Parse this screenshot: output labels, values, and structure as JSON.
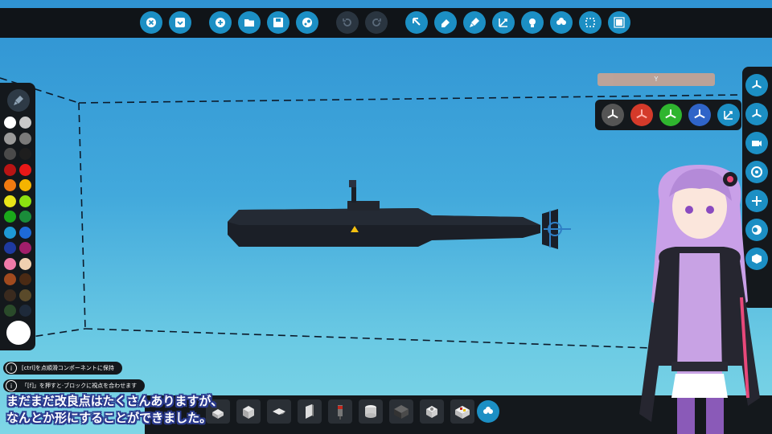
{
  "toolbar": {
    "buttons": [
      {
        "icon": "close-icon"
      },
      {
        "icon": "collapse-icon"
      },
      {
        "icon": "new-icon"
      },
      {
        "icon": "folder-icon"
      },
      {
        "icon": "save-icon"
      },
      {
        "icon": "steam-icon"
      },
      {
        "icon": "undo-icon"
      },
      {
        "icon": "redo-icon"
      },
      {
        "icon": "select-cursor-icon"
      },
      {
        "icon": "eraser-icon"
      },
      {
        "icon": "paint-icon"
      },
      {
        "icon": "transform-icon"
      },
      {
        "icon": "light-icon"
      },
      {
        "icon": "components-icon"
      },
      {
        "icon": "marquee-select-icon"
      },
      {
        "icon": "chip-icon"
      }
    ]
  },
  "palette": {
    "colors": [
      "#ffffff",
      "#c8c8c8",
      "#9a9a9a",
      "#7a7a7a",
      "#4a4a4a",
      "#1e1e1e",
      "#b81414",
      "#e81818",
      "#f07a10",
      "#f5b400",
      "#e8e418",
      "#8ce010",
      "#1aa81a",
      "#1a8c3a",
      "#1e9ad6",
      "#1e6ad6",
      "#1e3aa0",
      "#a01e6a",
      "#f07aa8",
      "#f0d0b0",
      "#a04a1e",
      "#4a2a14",
      "#3a2a1e",
      "#5a4a2a",
      "#2a4a2a",
      "#1e2a3a"
    ],
    "selected": "#ffffff"
  },
  "viewport": {
    "axis_label": "Y",
    "view_buttons": [
      {
        "icon": "view-axis-gray-icon",
        "color": "#555555"
      },
      {
        "icon": "view-axis-red-icon",
        "color": "#d43a2a"
      },
      {
        "icon": "view-axis-green-icon",
        "color": "#2fb52f"
      },
      {
        "icon": "view-axis-blue-icon",
        "color": "#2f64c8"
      },
      {
        "icon": "view-expand-icon",
        "color": "#1c8fc4"
      }
    ]
  },
  "right_panel": {
    "buttons": [
      "axis-icon",
      "axis-icon",
      "camera-icon",
      "target-icon",
      "arrows-icon",
      "orbit-icon",
      "block-icon"
    ]
  },
  "hints": [
    {
      "text": "[ctrl]を点順滑コンポーネントに保持"
    },
    {
      "text": "「[f]」を押すと·ブロックに視点を合わせます"
    }
  ],
  "bottom_bar": {
    "blocks": [
      "block-slab-icon",
      "block-cube-icon",
      "block-wedge-icon",
      "block-panel-icon",
      "block-thruster-icon",
      "block-cylinder-icon",
      "block-engine-icon",
      "block-pipe-icon",
      "block-control-icon"
    ],
    "menu_icon": "components-icon"
  },
  "subtitles": {
    "line1": "まだまだ改良点はたくさんありますが、",
    "line2": "なんとか形にすることができました。"
  },
  "colors": {
    "accent": "#1c8fc4",
    "sub_outline": "#2a3a8f"
  }
}
